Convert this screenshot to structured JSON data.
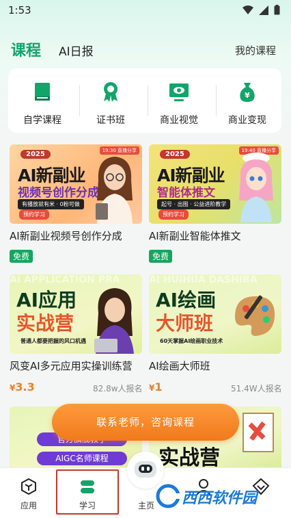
{
  "status": {
    "time": "1:53"
  },
  "header": {
    "tab_course": "课程",
    "tab_daily": "AI日报",
    "my_course": "我的课程"
  },
  "categories": [
    {
      "label": "自学课程",
      "icon": "book-icon"
    },
    {
      "label": "证书班",
      "icon": "award-icon"
    },
    {
      "label": "商业视觉",
      "icon": "monitor-eye-icon"
    },
    {
      "label": "商业变现",
      "icon": "money-bag-icon"
    }
  ],
  "courses": [
    {
      "title": "AI新副业视频号创作分成",
      "badge": "免费",
      "image": {
        "year": "2025",
        "live": "19:30 直播分享",
        "main": "AI新副业",
        "sub": "视频号创作分成",
        "tag": "有播放就有米 · 0粉可做",
        "book": "预约学习"
      }
    },
    {
      "title": "AI新副业智能体推文",
      "badge": "免费",
      "image": {
        "year": "2025",
        "live": "19:40 直播分享",
        "main": "AI新副业",
        "sub": "智能体推文",
        "tag": "起号 · 出图 · 公益进阶教学",
        "book": "预约学习"
      }
    },
    {
      "title": "风变AI多元应用实操训练营",
      "price": "3.3",
      "currency": "¥",
      "signup": "82.8w人报名",
      "image": {
        "bg": "AI APPLICATION PRA",
        "main": "AI应用",
        "sub": "实战营",
        "tag": "普通人都要把握的风口机遇"
      }
    },
    {
      "title": "AI绘画大师班",
      "price": "1",
      "currency": "¥",
      "signup": "51.4W人报名",
      "image": {
        "bg": "AI HUIHUA DASHIBA",
        "main": "AI绘画",
        "sub": "大师班",
        "tag": "60天掌握AI绘画职业技术"
      }
    }
  ],
  "row3": {
    "left_lines": [
      "官方旗舰教学",
      "AIGC名师课程"
    ],
    "right_text": "实战营"
  },
  "cta": {
    "label": "联系老师，咨询课程"
  },
  "nav": [
    {
      "label": "应用",
      "icon": "app-hexagon-icon"
    },
    {
      "label": "学习",
      "icon": "study-icon"
    },
    {
      "label": "主页",
      "icon": "robot-icon"
    },
    {
      "label": "",
      "icon": "profile-icon"
    },
    {
      "label": "",
      "icon": "diamond-icon"
    }
  ],
  "watermark": "西西软件园",
  "colors": {
    "accent": "#11a56b",
    "cta": "#f28a2c",
    "price": "#e8812b",
    "free": "#15a660"
  }
}
